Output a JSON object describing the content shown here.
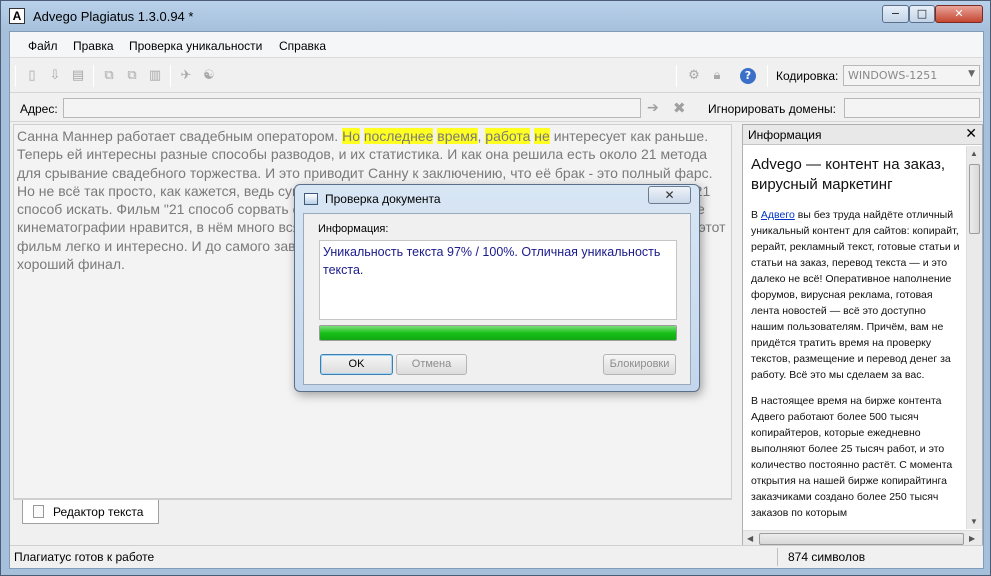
{
  "window": {
    "title": "Advego Plagiatus 1.3.0.94 *",
    "icon_letter": "A",
    "minimize": "−",
    "maximize": "□",
    "close": "✕"
  },
  "menu": {
    "file": "Файл",
    "edit": "Правка",
    "check": "Проверка уникальности",
    "help": "Справка"
  },
  "toolbar": {
    "encoding_label": "Кодировка:",
    "encoding_value": "WINDOWS-1251",
    "help_glyph": "?"
  },
  "address": {
    "label": "Адрес:",
    "value": "",
    "ignore_label": "Игнорировать домены:",
    "ignore_value": ""
  },
  "editor": {
    "text_before": "Санна Маннер работает свадебным оператором. ",
    "hl1": "Но",
    "sp1": " ",
    "hl2": "последнее",
    "sp2": " ",
    "hl3": "время",
    "sp3": ", ",
    "hl4": "работа",
    "sp4": " ",
    "hl5": "не",
    "text_after": " интересует как раньше. Теперь ей интересны разные способы разводов, и их статистика. И как она решила есть около 21 метода для срывание свадебного торжества. И это приводит Санну к заключению, что её брак - это полный фарс. Но не всё так просто, как кажется, ведь супругов связывает прочная любовь и её кажется что есть еще 21 способ искать. Фильм \"21 способ сорвать свадьбу\" - это отличный фильм для тех, кого это произведение кинематографии нравится, в нём много всяких крутых моментов, которые могут понравиться. Смотреть этот фильм легко и интересно. И до самого завершения фильм захватывает. И кстати, фильм имеет очень хороший финал.",
    "tab_label": "Редактор текста"
  },
  "info_panel": {
    "title": "Информация",
    "close": "✕",
    "heading": "Advego — контент на заказ, вирусный маркетинг",
    "p1_pre": "В ",
    "p1_link": "Адвего",
    "p1_post": " вы без труда найдёте отличный уникальный контент для сайтов: копирайт, рерайт, рекламный текст, готовые статьи и статьи на заказ, перевод текста — и это далеко не всё! Оперативное наполнение форумов, вирусная реклама, готовая лента новостей — всё это доступно нашим пользователям. Причём, вам не придётся тратить время на проверку текстов, размещение и перевод денег за работу. Всё это мы сделаем за вас.",
    "p2": "В настоящее время на бирже контента Адвего работают более 500 тысяч копирайтеров, которые ежедневно выполняют более 25 тысяч работ, и это количество постоянно растёт. С момента открытия на нашей бирже копирайтинга заказчиками создано более 250 тысяч заказов по которым"
  },
  "status": {
    "left": "Плагиатус готов к работе",
    "right": "874 символов"
  },
  "dialog": {
    "title": "Проверка документа",
    "close": "✕",
    "info_label": "Информация:",
    "message": "Уникальность текста 97% / 100%. Отличная уникальность текста.",
    "progress": 1.0,
    "ok": "OK",
    "cancel": "Отмена",
    "block": "Блокировки"
  },
  "colors": {
    "highlight": "#ffff22",
    "progress": "#19c019",
    "link": "#0033cc"
  }
}
